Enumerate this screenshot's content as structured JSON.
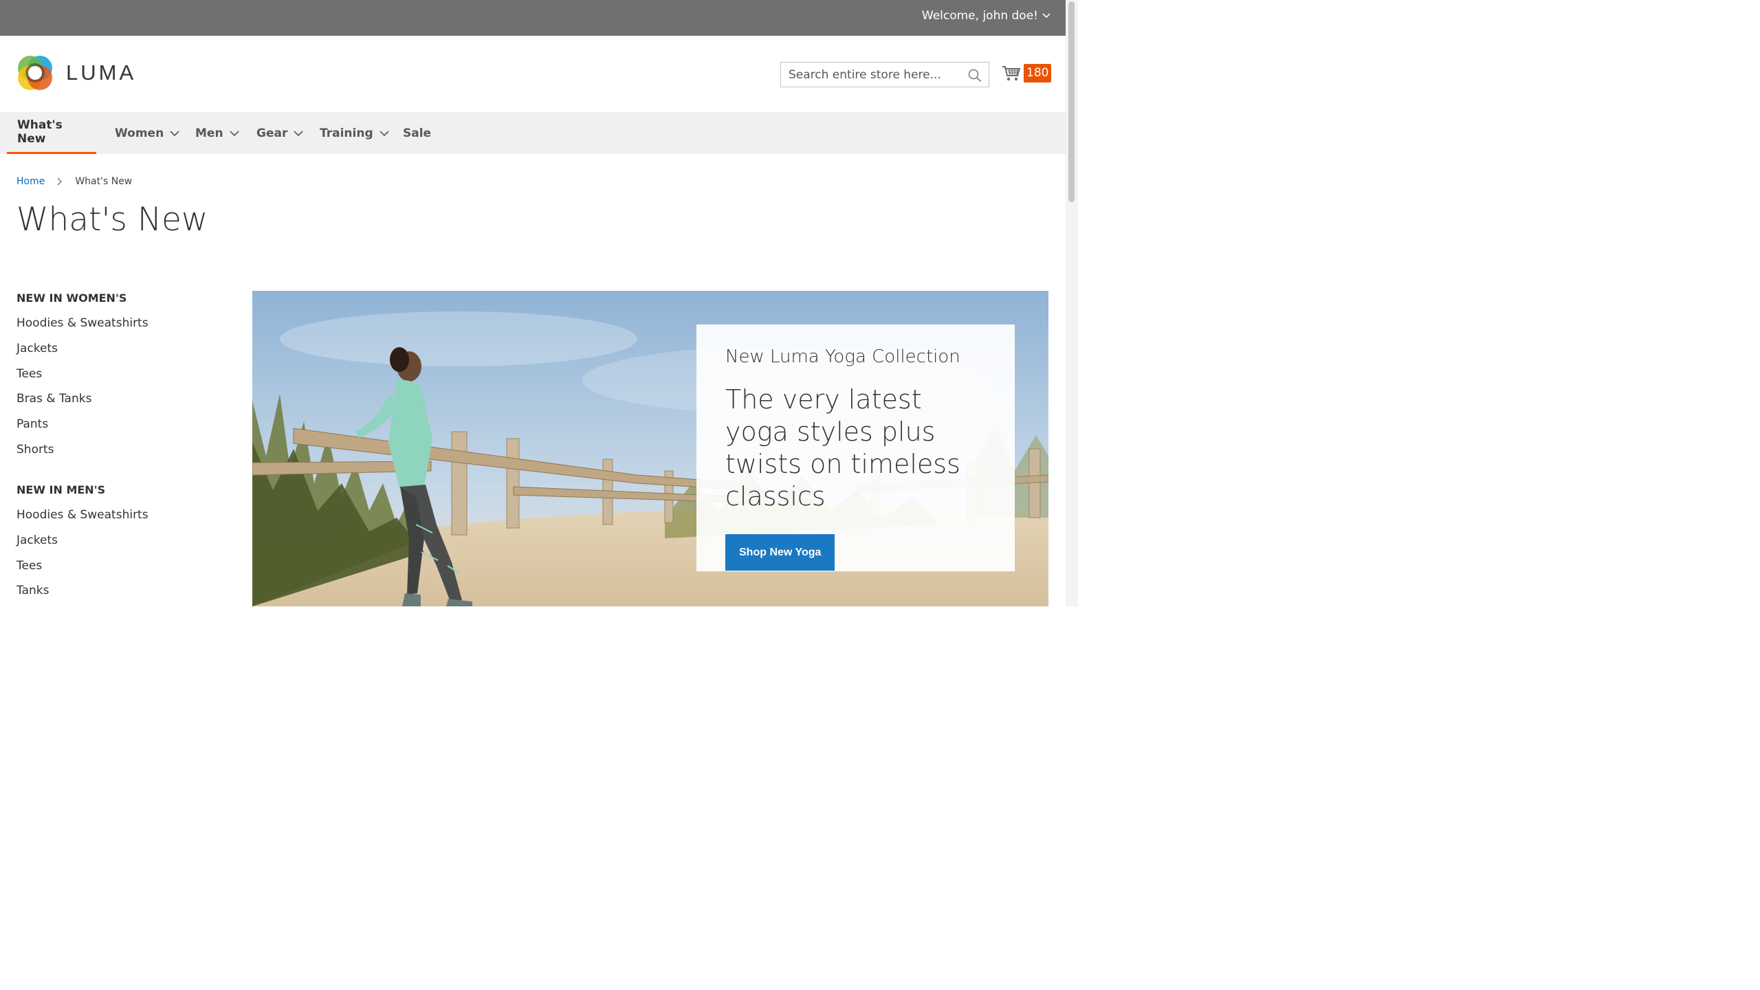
{
  "topbar": {
    "welcome": "Welcome, john doe!"
  },
  "header": {
    "logo_text": "LUMA",
    "search_placeholder": "Search entire store here...",
    "cart_count": "180"
  },
  "nav": {
    "items": [
      {
        "label": "What's New",
        "active": true
      },
      {
        "label": "Women",
        "has_dropdown": true
      },
      {
        "label": "Men",
        "has_dropdown": true
      },
      {
        "label": "Gear",
        "has_dropdown": true
      },
      {
        "label": "Training",
        "has_dropdown": true
      },
      {
        "label": "Sale"
      }
    ]
  },
  "breadcrumb": {
    "home": "Home",
    "current": "What's New"
  },
  "page_title": "What's New",
  "sidebar": {
    "groups": [
      {
        "heading": "NEW IN WOMEN'S",
        "links": [
          "Hoodies & Sweatshirts",
          "Jackets",
          "Tees",
          "Bras & Tanks",
          "Pants",
          "Shorts"
        ]
      },
      {
        "heading": "NEW IN MEN'S",
        "links": [
          "Hoodies & Sweatshirts",
          "Jackets",
          "Tees",
          "Tanks"
        ]
      }
    ]
  },
  "hero": {
    "subtitle": "New Luma Yoga Collection",
    "title": "The very latest yoga styles plus twists on timeless classics",
    "button": "Shop New Yoga"
  },
  "colors": {
    "topbar": "#6e716e",
    "accent": "#ff5501",
    "cart_badge": "#eb5202",
    "link": "#006bb4",
    "button": "#1979c3"
  }
}
